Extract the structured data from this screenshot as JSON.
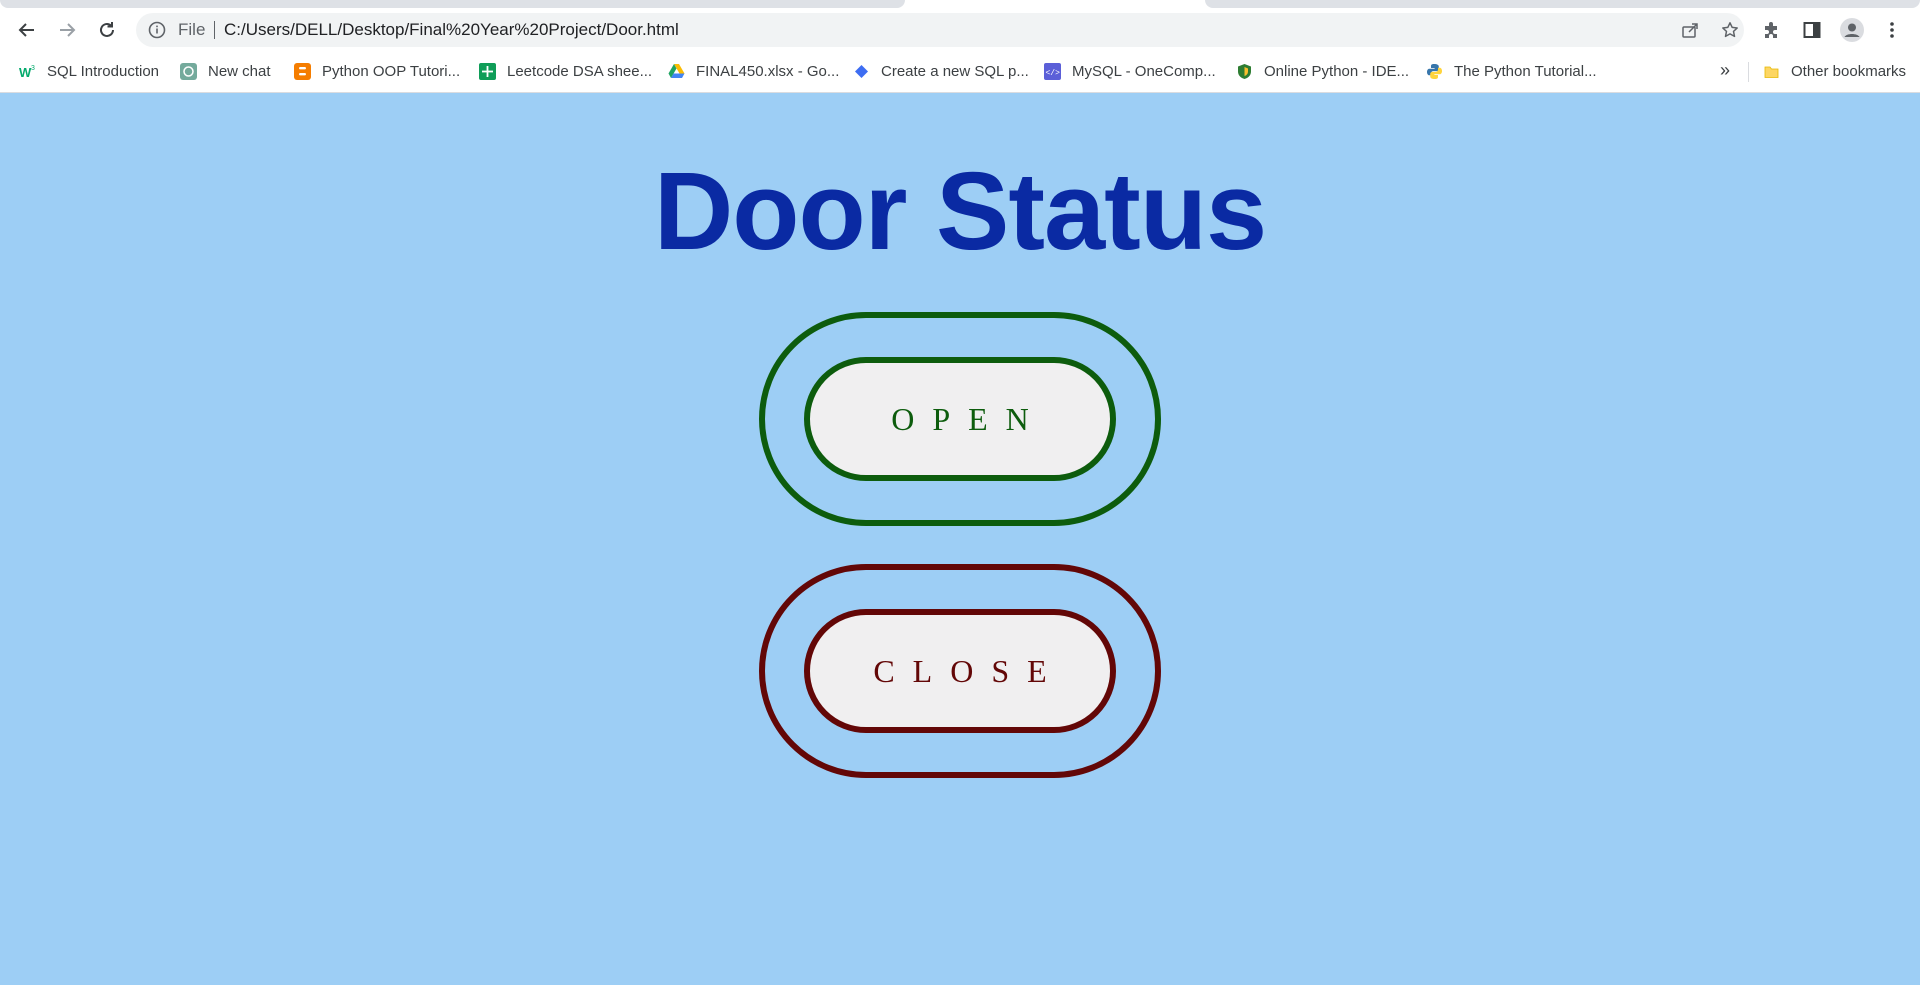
{
  "browser": {
    "address": {
      "scheme_label": "File",
      "url": "C:/Users/DELL/Desktop/Final%20Year%20Project/Door.html"
    },
    "bookmarks": [
      {
        "label": "SQL Introduction",
        "icon": "w3schools-icon"
      },
      {
        "label": "New chat",
        "icon": "chatgpt-icon"
      },
      {
        "label": "Python OOP Tutori...",
        "icon": "blogger-icon"
      },
      {
        "label": "Leetcode DSA shee...",
        "icon": "google-sheets-icon"
      },
      {
        "label": "FINAL450.xlsx - Go...",
        "icon": "google-drive-icon"
      },
      {
        "label": "Create a new SQL p...",
        "icon": "dropbox-icon"
      },
      {
        "label": "MySQL - OneComp...",
        "icon": "onecompiler-icon"
      },
      {
        "label": "Online Python - IDE...",
        "icon": "shield-icon"
      },
      {
        "label": "The Python Tutorial...",
        "icon": "python-icon"
      }
    ],
    "more_bookmarks": "»",
    "other_bookmarks": "Other bookmarks"
  },
  "page": {
    "title": "Door Status",
    "open_button": "OPEN",
    "close_button": "CLOSE"
  },
  "colors": {
    "background": "#9dcef5",
    "title": "#0a2aa3",
    "open": "#0d5c0d",
    "close": "#630707",
    "button_fill": "#f0eff0"
  }
}
